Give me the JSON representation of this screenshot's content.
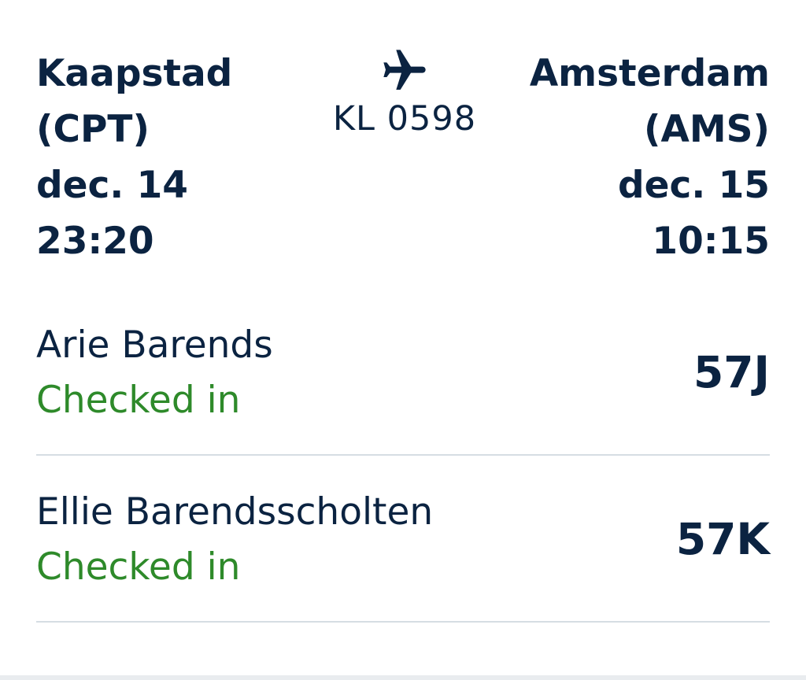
{
  "flight": {
    "origin": {
      "city": "Kaapstad",
      "code": "(CPT)",
      "date": "dec. 14",
      "time": "23:20"
    },
    "destination": {
      "city": "Amsterdam",
      "code": "(AMS)",
      "date": "dec. 15",
      "time": "10:15"
    },
    "flight_number": "KL 0598",
    "icon": "airplane-icon"
  },
  "passengers": [
    {
      "name": "Arie Barends",
      "status": "Checked in",
      "seat": "57J"
    },
    {
      "name": "Ellie Barendsscholten",
      "status": "Checked in",
      "seat": "57K"
    }
  ],
  "colors": {
    "text": "#0b2341",
    "status_checked_in": "#2e8a2a",
    "divider": "#d6dde3"
  }
}
